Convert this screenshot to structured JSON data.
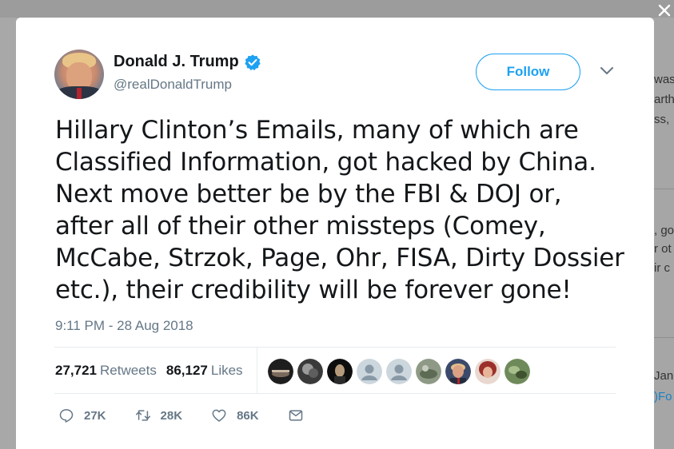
{
  "tweet": {
    "author": {
      "display_name": "Donald J. Trump",
      "handle": "@realDonaldTrump",
      "verified": true,
      "avatar_icon": "profile-photo"
    },
    "follow_label": "Follow",
    "text_lines": [
      "Hillary Clinton’s Emails, many of which are",
      "Classified Information, got hacked by China.",
      "Next move better be by the FBI & DOJ or,",
      "after all of their other missteps (Comey,",
      "McCabe, Strzok, Page, Ohr, FISA, Dirty Dossier",
      "etc.), their credibility will be forever gone!"
    ],
    "timestamp": "9:11 PM - 28 Aug 2018",
    "stats": {
      "retweets_count": "27,721",
      "retweets_label": "Retweets",
      "likes_count": "86,127",
      "likes_label": "Likes"
    },
    "liked_by_avatars": [
      {
        "icon": "user-avatar-dark"
      },
      {
        "icon": "user-avatar-dark"
      },
      {
        "icon": "user-avatar-dark"
      },
      {
        "icon": "default-avatar"
      },
      {
        "icon": "default-avatar"
      },
      {
        "icon": "user-avatar-photo"
      },
      {
        "icon": "user-avatar-photo"
      },
      {
        "icon": "user-avatar-photo"
      },
      {
        "icon": "user-avatar-photo"
      }
    ],
    "actions": {
      "reply_count": "27K",
      "retweet_count": "28K",
      "like_count": "86K"
    }
  },
  "background": {
    "right_fragments": [
      "was",
      "arth",
      "ss, ",
      ", go",
      "r ot",
      "ir c",
      "Jan",
      ")Fo"
    ]
  },
  "colors": {
    "accent": "#1da1f2",
    "text": "#14171a",
    "secondary": "#657786",
    "overlay": "#a8a8a8"
  }
}
